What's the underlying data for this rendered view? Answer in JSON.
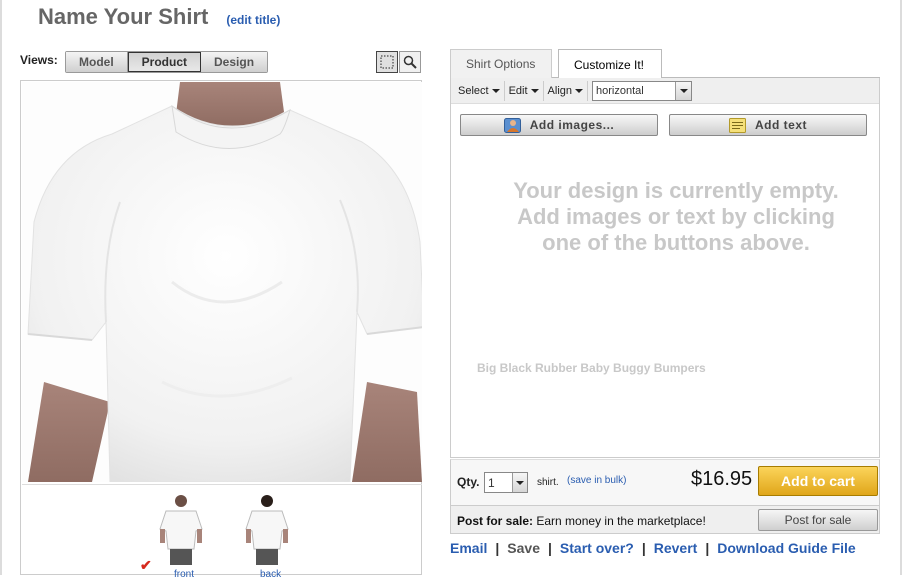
{
  "header": {
    "title": "Name Your Shirt",
    "edit_title": "(edit title)"
  },
  "views": {
    "label": "Views:",
    "buttons": [
      "Model",
      "Product",
      "Design"
    ],
    "active": "Product"
  },
  "thumbnails": {
    "front": "front",
    "back": "back"
  },
  "tabs": {
    "options": "Shirt Options",
    "customize": "Customize It!"
  },
  "toolbar": {
    "select": "Select",
    "edit": "Edit",
    "align": "Align",
    "orientation": "horizontal"
  },
  "actions": {
    "add_images": "Add images...",
    "add_text": "Add text"
  },
  "canvas": {
    "empty_lines": [
      "Your design is currently empty.",
      "Add images or text by clicking",
      "one of the buttons above."
    ],
    "sample_text": "Big Black Rubber Baby Buggy Bumpers"
  },
  "order": {
    "qty_label": "Qty.",
    "qty_value": "1",
    "unit": "shirt.",
    "save_in_bulk": "(save in bulk)",
    "price": "$16.95",
    "add_to_cart": "Add to cart"
  },
  "post": {
    "label": "Post for sale:",
    "text": " Earn money in the marketplace!",
    "button": "Post for sale"
  },
  "links": {
    "email": "Email",
    "save": "Save",
    "start_over": "Start over?",
    "revert": "Revert",
    "download": "Download Guide File"
  },
  "colors": {
    "link": "#2a5db0",
    "cart_button": "#f0bd35",
    "empty_text": "#c8c8c8"
  },
  "icons": [
    "grid-select-icon",
    "magnifier-icon",
    "image-icon",
    "text-note-icon",
    "check-icon",
    "dropdown-arrow-icon"
  ]
}
